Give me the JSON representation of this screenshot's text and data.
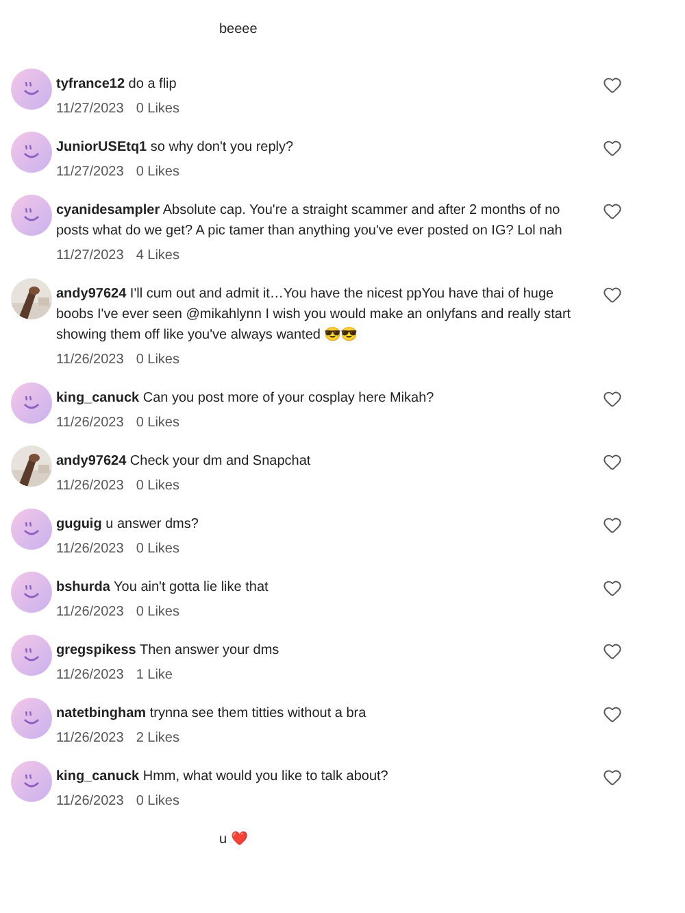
{
  "comments": [
    {
      "kind": "partial",
      "text": "beeee"
    },
    {
      "kind": "comment",
      "avatar": {
        "kind": "smiley"
      },
      "text": "**tyfrance12** do a flip",
      "date": "11/27/2023",
      "likes": "0 Likes"
    },
    {
      "kind": "comment",
      "avatar": {
        "kind": "smiley"
      },
      "text": "**JuniorUSEtq1** so why don't you reply?",
      "date": "11/27/2023",
      "likes": "0 Likes"
    },
    {
      "kind": "comment",
      "avatar": {
        "kind": "smiley"
      },
      "text": "**cyanidesampler** Absolute cap. You're a straight scammer and after 2 months of no posts what do we get? A pic tamer than anything you've ever posted on IG? Lol nah",
      "date": "11/27/2023",
      "likes": "4 Likes"
    },
    {
      "kind": "comment",
      "text": "**andy97624** I'll cum out and admit it…You have the nicest ppYou have thai of huge boobs I've ever seen @mikahlynn I wish you would make an onlyfans and really start showing them off like you've always wanted 😎😎",
      "date": "11/26/2023",
      "likes": "0 Likes"
    },
    {
      "kind": "comment",
      "avatar": {
        "kind": "smiley"
      },
      "text": "**king_canuck** Can you post more of your cosplay here Mikah?",
      "date": "11/26/2023",
      "likes": "0 Likes"
    },
    {
      "kind": "comment",
      "text": "**andy97624** Check your dm and Snapchat",
      "date": "11/26/2023",
      "likes": "0 Likes"
    },
    {
      "kind": "comment",
      "avatar": {
        "kind": "smiley"
      },
      "text": "**guguig** u answer dms?",
      "date": "11/26/2023",
      "likes": "0 Likes"
    },
    {
      "kind": "comment",
      "avatar": {
        "kind": "smiley"
      },
      "text": "**bshurda** You ain't gotta lie like that",
      "date": "11/26/2023",
      "likes": "0 Likes"
    },
    {
      "kind": "comment",
      "avatar": {
        "kind": "smiley"
      },
      "text": "**gregspikess** Then answer your dms",
      "date": "11/26/2023",
      "likes": "1 Like"
    },
    {
      "kind": "comment",
      "avatar": {
        "kind": "smiley"
      },
      "text": "**natetbingham** trynna see them titties without a bra",
      "date": "11/26/2023",
      "likes": "2 Likes"
    },
    {
      "kind": "comment",
      "avatar": {
        "kind": "smiley"
      },
      "text": "**king_canuck** Hmm, what would you like to talk about?",
      "date": "11/26/2023",
      "likes": "0 Likes"
    },
    {
      "kind": "partial",
      "text": "u ❤️"
    }
  ]
}
